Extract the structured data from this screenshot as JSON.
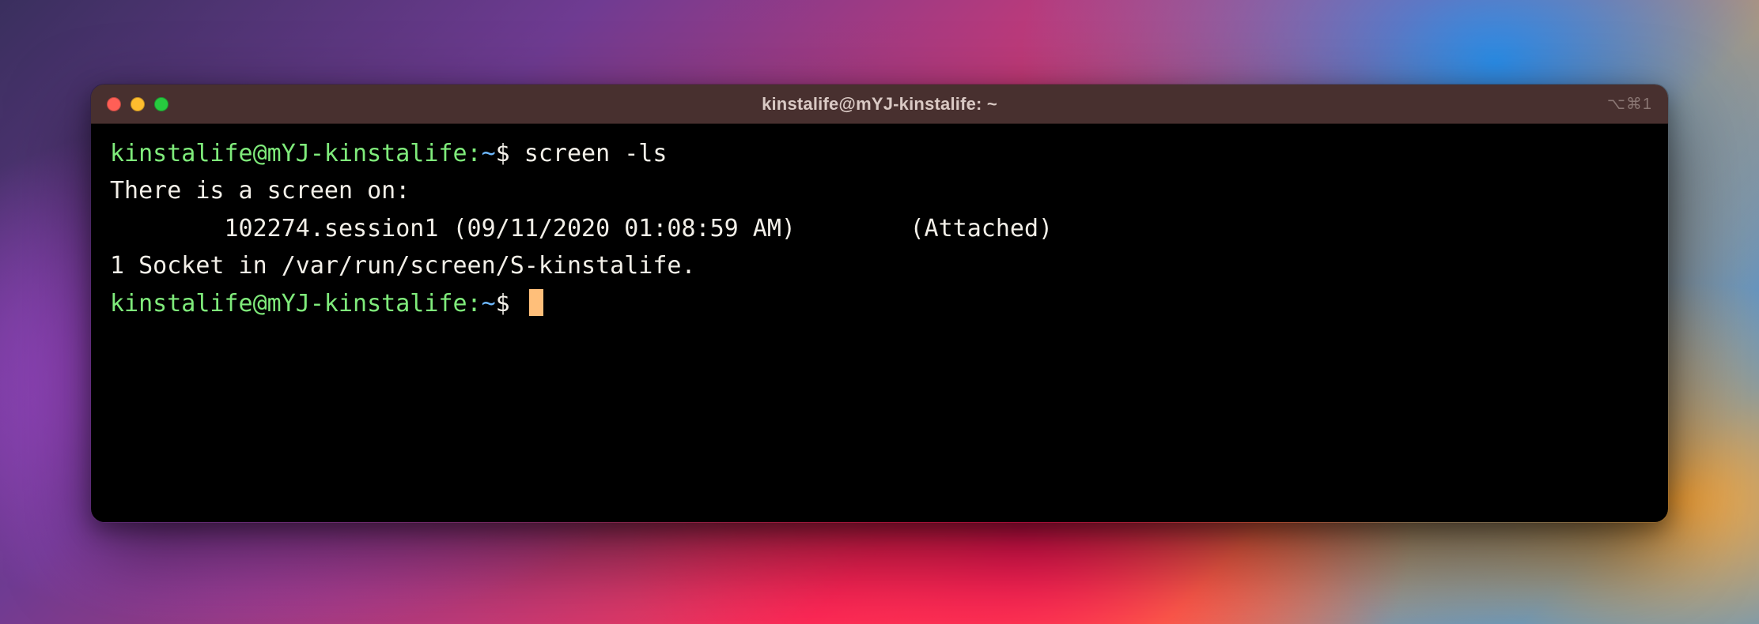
{
  "window": {
    "title": "kinstalife@mYJ-kinstalife: ~",
    "shortcut_hint": "⌥⌘1"
  },
  "prompts": [
    {
      "user_host": "kinstalife@mYJ-kinstalife",
      "sep": ":",
      "path": "~",
      "dollar": "$",
      "command": "screen -ls"
    },
    {
      "user_host": "kinstalife@mYJ-kinstalife",
      "sep": ":",
      "path": "~",
      "dollar": "$",
      "command": ""
    }
  ],
  "output": {
    "line1": "There is a screen on:",
    "line2": "        102274.session1 (09/11/2020 01:08:59 AM)        (Attached)",
    "line3": "1 Socket in /var/run/screen/S-kinstalife."
  }
}
